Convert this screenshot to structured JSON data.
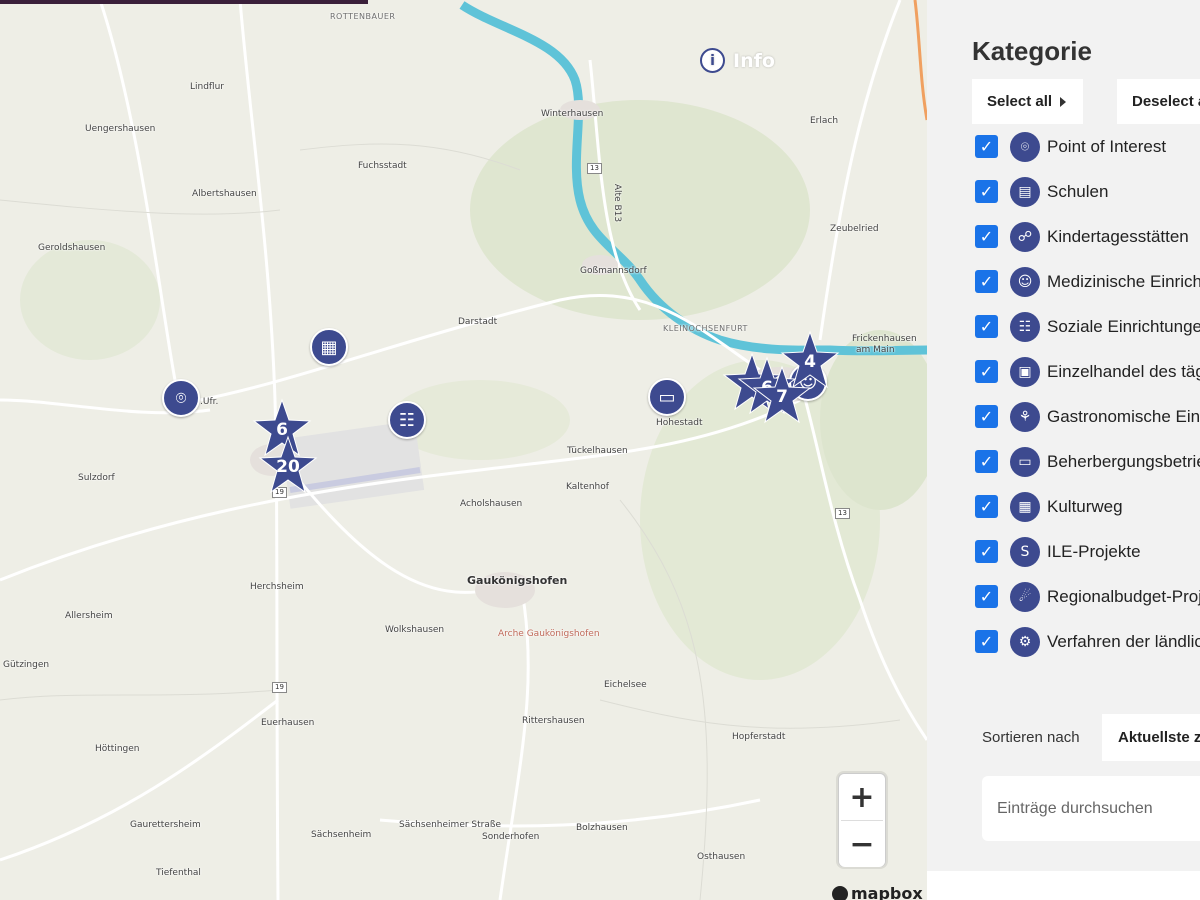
{
  "map": {
    "info_label": "Info",
    "attribution": "mapbox",
    "zoom_in": "+",
    "zoom_out": "−",
    "places": [
      {
        "id": "rottenbauer",
        "label": "ROTTENBAUER",
        "style": "small"
      },
      {
        "id": "lindflur",
        "label": "Lindflur",
        "style": ""
      },
      {
        "id": "uengershausen",
        "label": "Uengershausen",
        "style": ""
      },
      {
        "id": "albertshausen",
        "label": "Albertshausen",
        "style": ""
      },
      {
        "id": "fuchsstadt",
        "label": "Fuchsstadt",
        "style": ""
      },
      {
        "id": "geroldshausen",
        "label": "Geroldshausen",
        "style": ""
      },
      {
        "id": "winterhausen",
        "label": "Winterhausen",
        "style": ""
      },
      {
        "id": "erlach",
        "label": "Erlach",
        "style": ""
      },
      {
        "id": "zeubelried",
        "label": "Zeubelried",
        "style": ""
      },
      {
        "id": "gossmannsdorf",
        "label": "Goßmannsdorf",
        "style": ""
      },
      {
        "id": "darstadt",
        "label": "Darstadt",
        "style": ""
      },
      {
        "id": "kleinochsenfurt",
        "label": "KLEINOCHSENFURT",
        "style": "small"
      },
      {
        "id": "frickenhausen",
        "label": "Frickenhausen",
        "style": ""
      },
      {
        "id": "ammain",
        "label": "am Main",
        "style": ""
      },
      {
        "id": "hohestadt",
        "label": "Hohestadt",
        "style": ""
      },
      {
        "id": "sulzdorf",
        "label": "Sulzdorf",
        "style": ""
      },
      {
        "id": "tueckelhausen",
        "label": "Tückelhausen",
        "style": ""
      },
      {
        "id": "kaltenhof",
        "label": "Kaltenhof",
        "style": ""
      },
      {
        "id": "acholshausen",
        "label": "Acholshausen",
        "style": ""
      },
      {
        "id": "gaukoenigshofen",
        "label": "Gaukönigshofen",
        "style": "big"
      },
      {
        "id": "herchsheim",
        "label": "Herchsheim",
        "style": ""
      },
      {
        "id": "allersheim",
        "label": "Allersheim",
        "style": ""
      },
      {
        "id": "wolkshausen",
        "label": "Wolkshausen",
        "style": ""
      },
      {
        "id": "arche",
        "label": "Arche Gaukönigshofen",
        "style": "green"
      },
      {
        "id": "guetzingen",
        "label": "Gützingen",
        "style": ""
      },
      {
        "id": "eichelsee",
        "label": "Eichelsee",
        "style": ""
      },
      {
        "id": "rittershausen",
        "label": "Rittershausen",
        "style": ""
      },
      {
        "id": "hopferstadt",
        "label": "Hopferstadt",
        "style": ""
      },
      {
        "id": "euerhausen",
        "label": "Euerhausen",
        "style": ""
      },
      {
        "id": "hoettingen",
        "label": "Höttingen",
        "style": ""
      },
      {
        "id": "gaurettersheim",
        "label": "Gaurettersheim",
        "style": ""
      },
      {
        "id": "saechsenheim",
        "label": "Sächsenheim",
        "style": ""
      },
      {
        "id": "saechsenheimer-str",
        "label": "Sächsenheimer Straße",
        "style": ""
      },
      {
        "id": "sonderhofen",
        "label": "Sonderhofen",
        "style": ""
      },
      {
        "id": "bolzhausen",
        "label": "Bolzhausen",
        "style": ""
      },
      {
        "id": "osthausen",
        "label": "Osthausen",
        "style": ""
      },
      {
        "id": "tiefenthal",
        "label": "Tiefenthal",
        "style": ""
      },
      {
        "id": "ufr",
        "label": ".Ufr.",
        "style": ""
      },
      {
        "id": "alte-b13",
        "label": "Alte B13",
        "style": ""
      }
    ],
    "road_numbers": [
      {
        "id": "b13-north",
        "label": "13"
      },
      {
        "id": "b19-center",
        "label": "19"
      },
      {
        "id": "b13-east",
        "label": "13"
      },
      {
        "id": "b19-south",
        "label": "19"
      }
    ],
    "clusters": [
      {
        "id": "cluster-6",
        "count": "6"
      },
      {
        "id": "cluster-20",
        "count": "20"
      },
      {
        "id": "cluster-4",
        "count": "4"
      },
      {
        "id": "cluster-6b",
        "count": "6"
      },
      {
        "id": "cluster-7",
        "count": "7"
      }
    ],
    "pois": [
      {
        "id": "poi-kulturweg",
        "icon": "map-book-icon"
      },
      {
        "id": "poi-location",
        "icon": "location-pin-icon"
      },
      {
        "id": "poi-soziale",
        "icon": "people-meeting-icon"
      },
      {
        "id": "poi-hotel",
        "icon": "bed-icon"
      },
      {
        "id": "poi-medical",
        "icon": "doctor-icon"
      }
    ],
    "colors": {
      "marker": "#3d4a8f",
      "water": "#5fc3d8",
      "land": "#eeeee6"
    }
  },
  "sidebar": {
    "title": "Kategorie",
    "select_all": "Select all",
    "deselect_all": "Deselect all",
    "categories": [
      {
        "label": "Point of Interest",
        "icon": "location-pin-icon",
        "checked": true
      },
      {
        "label": "Schulen",
        "icon": "school-board-icon",
        "checked": true
      },
      {
        "label": "Kindertagesstätten",
        "icon": "family-icon",
        "checked": true
      },
      {
        "label": "Medizinische Einrichtungen",
        "icon": "doctor-icon",
        "checked": true
      },
      {
        "label": "Soziale Einrichtungen",
        "icon": "people-meeting-icon",
        "checked": true
      },
      {
        "label": "Einzelhandel des täglichen Bedarfs",
        "icon": "shop-icon",
        "checked": true
      },
      {
        "label": "Gastronomische Einrichtungen",
        "icon": "cutlery-icon",
        "checked": true
      },
      {
        "label": "Beherbergungsbetriebe",
        "icon": "bed-icon",
        "checked": true
      },
      {
        "label": "Kulturweg",
        "icon": "map-book-icon",
        "checked": true
      },
      {
        "label": "ILE-Projekte",
        "icon": "ile-logo-icon",
        "checked": true
      },
      {
        "label": "Regionalbudget-Projekte",
        "icon": "hand-money-icon",
        "checked": true
      },
      {
        "label": "Verfahren der ländlichen Entwicklung",
        "icon": "tractor-icon",
        "checked": true
      }
    ],
    "sort_label": "Sortieren nach",
    "sort_value": "Aktuellste zuerst",
    "search_placeholder": "Einträge durchsuchen",
    "checkbox_color": "#1a73e8"
  }
}
